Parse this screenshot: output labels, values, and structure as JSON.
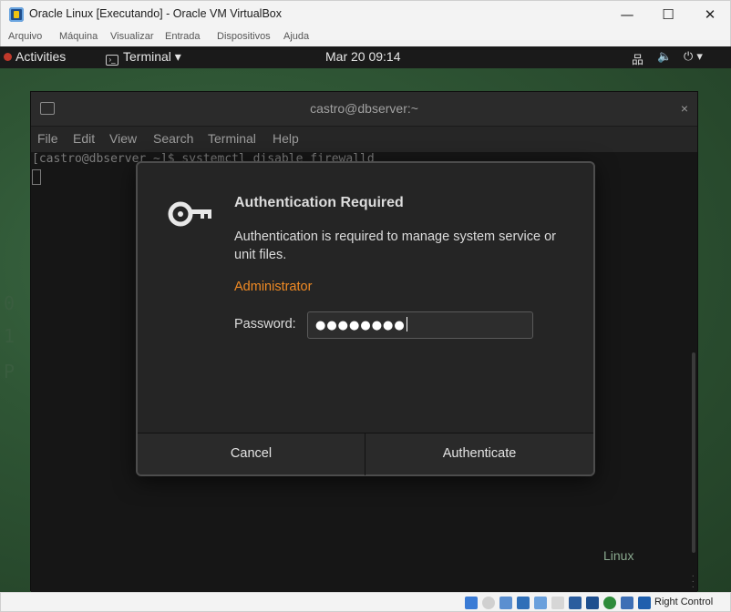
{
  "window": {
    "title": "Oracle Linux [Executando] - Oracle VM VirtualBox",
    "controls": {
      "minimize": "—",
      "maximize": "☐",
      "close": "✕"
    }
  },
  "vbox_menu": [
    "Arquivo",
    "Máquina",
    "Visualizar",
    "Entrada",
    "Dispositivos",
    "Ajuda"
  ],
  "gnome_topbar": {
    "activities": "Activities",
    "app_menu": "Terminal ▾",
    "clock": "Mar 20  09:14",
    "tray_network": "品",
    "tray_volume": "🔈",
    "tray_power": "⏻ ▾"
  },
  "terminal": {
    "title": "castro@dbserver:~",
    "close": "×",
    "menu": [
      "File",
      "Edit",
      "View",
      "Search",
      "Terminal",
      "Help"
    ],
    "line1": "[castro@dbserver ~]$ systemctl disable firewalld"
  },
  "desktop": {
    "logo_text": "Linux"
  },
  "auth_dialog": {
    "title": "Authentication Required",
    "message": "Authentication is required to manage system service or unit files.",
    "user": "Administrator",
    "password_label": "Password:",
    "password_value": "●●●●●●●●",
    "cancel": "Cancel",
    "authenticate": "Authenticate"
  },
  "status_bar": {
    "host_key": "Right Control"
  }
}
